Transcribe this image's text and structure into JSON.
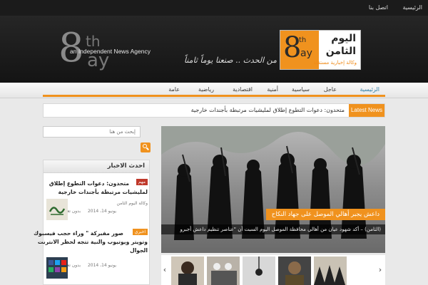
{
  "topbar": {
    "links": [
      "الرئيسية",
      "اتصل بنا"
    ]
  },
  "header": {
    "logo": {
      "num": "8",
      "sup": "th",
      "sub": "ay",
      "tagline": "an Independent News Agency"
    },
    "slogan": "من الحدث .. صنعنا يوماً ثامناً",
    "brand": {
      "num": "8",
      "sup": "th",
      "sub": "ay",
      "line1": "اليوم",
      "line2": "الثامن",
      "line3": "وكالة إخبارية مستقلة"
    },
    "colors": {
      "accent": "#f0921e",
      "dark": "#1b1b1b"
    }
  },
  "nav": {
    "items": [
      "الرئيسية",
      "عاجل",
      "سياسية",
      "أمنية",
      "اقتصادية",
      "رياضية",
      "عامة"
    ]
  },
  "ticker": {
    "label": "Latest News",
    "text": "متحدون: دعوات التطوع إطلاق لمليشيات مرتبطة بأجندات خارجية"
  },
  "search": {
    "placeholder": "إبحث من هنا"
  },
  "sidebar": {
    "title": "احدث الاخبار",
    "items": [
      {
        "badge": "مهم",
        "badge_color": "#c0392b",
        "title1": "متحدون: دعوات التطوع إطلاق",
        "title2": "لمليشيات مرتبطة بأجندات خارجية",
        "author": "وكالة اليوم الثامن",
        "date": "يونيو 14، 2014",
        "comments": "بدون تعليقات"
      },
      {
        "badge": "اخبري",
        "badge_color": "#f0921e",
        "title1": "صور مفبركة \" وراء حجب فيسبوك",
        "title2": "وتويتر ويوتيوب والنية تتجه لحظر الانترنت",
        "title3": "الجوال",
        "date": "يونيو 14، 2014",
        "comments": "بدون تعليقات"
      }
    ]
  },
  "featured": {
    "title": "داعش يجبر أهالي الموصل على جهاد النكاح",
    "text": "(الثامن) – أكد شهود عيان من أهالي محافظة الموصل اليوم السبت أن \"عناصر تنظيم داعش أجبرو"
  },
  "carousel": {
    "prev": "‹",
    "next": "›"
  }
}
